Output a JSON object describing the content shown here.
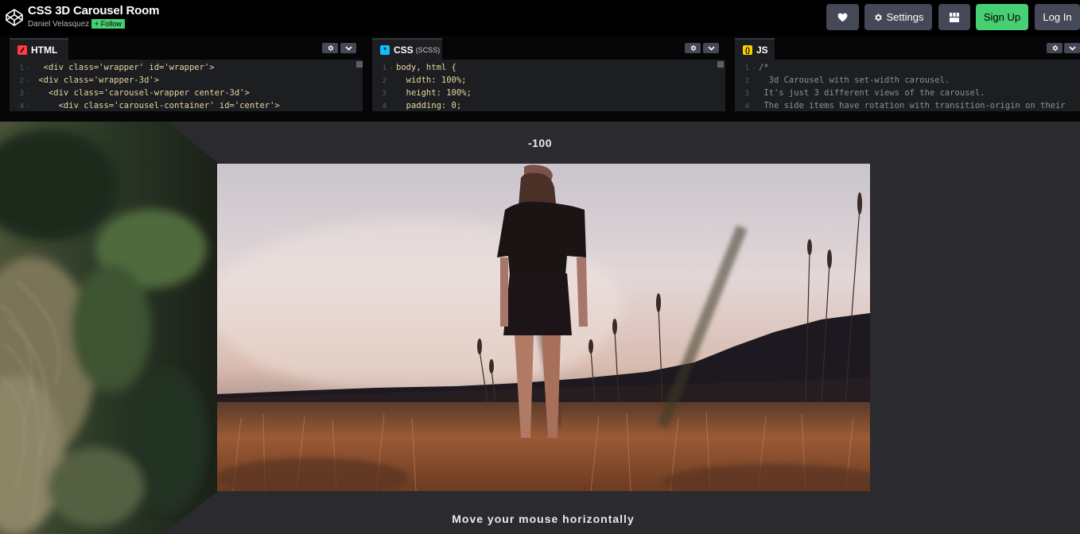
{
  "header": {
    "title": "CSS 3D Carousel Room",
    "author": "Daniel Velasquez",
    "follow_label": "+ Follow",
    "buttons": {
      "heart": "heart-icon",
      "settings_label": "Settings",
      "grid": "layout-grid-icon",
      "signup_label": "Sign Up",
      "login_label": "Log In"
    }
  },
  "editors": {
    "html": {
      "label": "HTML",
      "line_numbers": [
        "1",
        "2",
        "3",
        "4"
      ],
      "lines": [
        "  <div class='wrapper' id='wrapper'>",
        " <div class='wrapper-3d'>",
        "   <div class='carousel-wrapper center-3d'>",
        "     <div class='carousel-container' id='center'>"
      ]
    },
    "css": {
      "label": "CSS",
      "sub_label": "(SCSS)",
      "line_numbers": [
        "1",
        "2",
        "3",
        "4"
      ],
      "lines": [
        "body, html {",
        "  width: 100%;",
        "  height: 100%;",
        "  padding: 0;"
      ]
    },
    "js": {
      "label": "JS",
      "line_numbers": [
        "1",
        "2",
        "3",
        "4"
      ],
      "lines": [
        "/*",
        "  3d Carousel with set-width carousel.",
        " It's just 3 different views of the carousel.",
        " The side items have rotation with transition-origin on their"
      ]
    },
    "colors": {
      "html_badge": "#ff3c41",
      "css_badge": "#0ebeff",
      "js_badge": "#fcd000"
    }
  },
  "preview": {
    "counter": "-100",
    "hint": "Move your mouse horizontally"
  },
  "colors": {
    "accent_green": "#47cf73",
    "button_bg": "#444857",
    "preview_bg": "#2b2a2e"
  }
}
